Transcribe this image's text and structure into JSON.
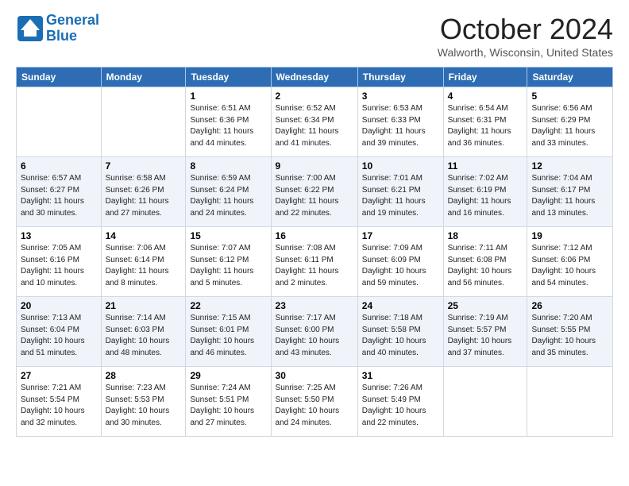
{
  "header": {
    "logo_line1": "General",
    "logo_line2": "Blue",
    "month_title": "October 2024",
    "location": "Walworth, Wisconsin, United States"
  },
  "days_of_week": [
    "Sunday",
    "Monday",
    "Tuesday",
    "Wednesday",
    "Thursday",
    "Friday",
    "Saturday"
  ],
  "weeks": [
    [
      {
        "day": "",
        "info": ""
      },
      {
        "day": "",
        "info": ""
      },
      {
        "day": "1",
        "info": "Sunrise: 6:51 AM\nSunset: 6:36 PM\nDaylight: 11 hours and 44 minutes."
      },
      {
        "day": "2",
        "info": "Sunrise: 6:52 AM\nSunset: 6:34 PM\nDaylight: 11 hours and 41 minutes."
      },
      {
        "day": "3",
        "info": "Sunrise: 6:53 AM\nSunset: 6:33 PM\nDaylight: 11 hours and 39 minutes."
      },
      {
        "day": "4",
        "info": "Sunrise: 6:54 AM\nSunset: 6:31 PM\nDaylight: 11 hours and 36 minutes."
      },
      {
        "day": "5",
        "info": "Sunrise: 6:56 AM\nSunset: 6:29 PM\nDaylight: 11 hours and 33 minutes."
      }
    ],
    [
      {
        "day": "6",
        "info": "Sunrise: 6:57 AM\nSunset: 6:27 PM\nDaylight: 11 hours and 30 minutes."
      },
      {
        "day": "7",
        "info": "Sunrise: 6:58 AM\nSunset: 6:26 PM\nDaylight: 11 hours and 27 minutes."
      },
      {
        "day": "8",
        "info": "Sunrise: 6:59 AM\nSunset: 6:24 PM\nDaylight: 11 hours and 24 minutes."
      },
      {
        "day": "9",
        "info": "Sunrise: 7:00 AM\nSunset: 6:22 PM\nDaylight: 11 hours and 22 minutes."
      },
      {
        "day": "10",
        "info": "Sunrise: 7:01 AM\nSunset: 6:21 PM\nDaylight: 11 hours and 19 minutes."
      },
      {
        "day": "11",
        "info": "Sunrise: 7:02 AM\nSunset: 6:19 PM\nDaylight: 11 hours and 16 minutes."
      },
      {
        "day": "12",
        "info": "Sunrise: 7:04 AM\nSunset: 6:17 PM\nDaylight: 11 hours and 13 minutes."
      }
    ],
    [
      {
        "day": "13",
        "info": "Sunrise: 7:05 AM\nSunset: 6:16 PM\nDaylight: 11 hours and 10 minutes."
      },
      {
        "day": "14",
        "info": "Sunrise: 7:06 AM\nSunset: 6:14 PM\nDaylight: 11 hours and 8 minutes."
      },
      {
        "day": "15",
        "info": "Sunrise: 7:07 AM\nSunset: 6:12 PM\nDaylight: 11 hours and 5 minutes."
      },
      {
        "day": "16",
        "info": "Sunrise: 7:08 AM\nSunset: 6:11 PM\nDaylight: 11 hours and 2 minutes."
      },
      {
        "day": "17",
        "info": "Sunrise: 7:09 AM\nSunset: 6:09 PM\nDaylight: 10 hours and 59 minutes."
      },
      {
        "day": "18",
        "info": "Sunrise: 7:11 AM\nSunset: 6:08 PM\nDaylight: 10 hours and 56 minutes."
      },
      {
        "day": "19",
        "info": "Sunrise: 7:12 AM\nSunset: 6:06 PM\nDaylight: 10 hours and 54 minutes."
      }
    ],
    [
      {
        "day": "20",
        "info": "Sunrise: 7:13 AM\nSunset: 6:04 PM\nDaylight: 10 hours and 51 minutes."
      },
      {
        "day": "21",
        "info": "Sunrise: 7:14 AM\nSunset: 6:03 PM\nDaylight: 10 hours and 48 minutes."
      },
      {
        "day": "22",
        "info": "Sunrise: 7:15 AM\nSunset: 6:01 PM\nDaylight: 10 hours and 46 minutes."
      },
      {
        "day": "23",
        "info": "Sunrise: 7:17 AM\nSunset: 6:00 PM\nDaylight: 10 hours and 43 minutes."
      },
      {
        "day": "24",
        "info": "Sunrise: 7:18 AM\nSunset: 5:58 PM\nDaylight: 10 hours and 40 minutes."
      },
      {
        "day": "25",
        "info": "Sunrise: 7:19 AM\nSunset: 5:57 PM\nDaylight: 10 hours and 37 minutes."
      },
      {
        "day": "26",
        "info": "Sunrise: 7:20 AM\nSunset: 5:55 PM\nDaylight: 10 hours and 35 minutes."
      }
    ],
    [
      {
        "day": "27",
        "info": "Sunrise: 7:21 AM\nSunset: 5:54 PM\nDaylight: 10 hours and 32 minutes."
      },
      {
        "day": "28",
        "info": "Sunrise: 7:23 AM\nSunset: 5:53 PM\nDaylight: 10 hours and 30 minutes."
      },
      {
        "day": "29",
        "info": "Sunrise: 7:24 AM\nSunset: 5:51 PM\nDaylight: 10 hours and 27 minutes."
      },
      {
        "day": "30",
        "info": "Sunrise: 7:25 AM\nSunset: 5:50 PM\nDaylight: 10 hours and 24 minutes."
      },
      {
        "day": "31",
        "info": "Sunrise: 7:26 AM\nSunset: 5:49 PM\nDaylight: 10 hours and 22 minutes."
      },
      {
        "day": "",
        "info": ""
      },
      {
        "day": "",
        "info": ""
      }
    ]
  ]
}
